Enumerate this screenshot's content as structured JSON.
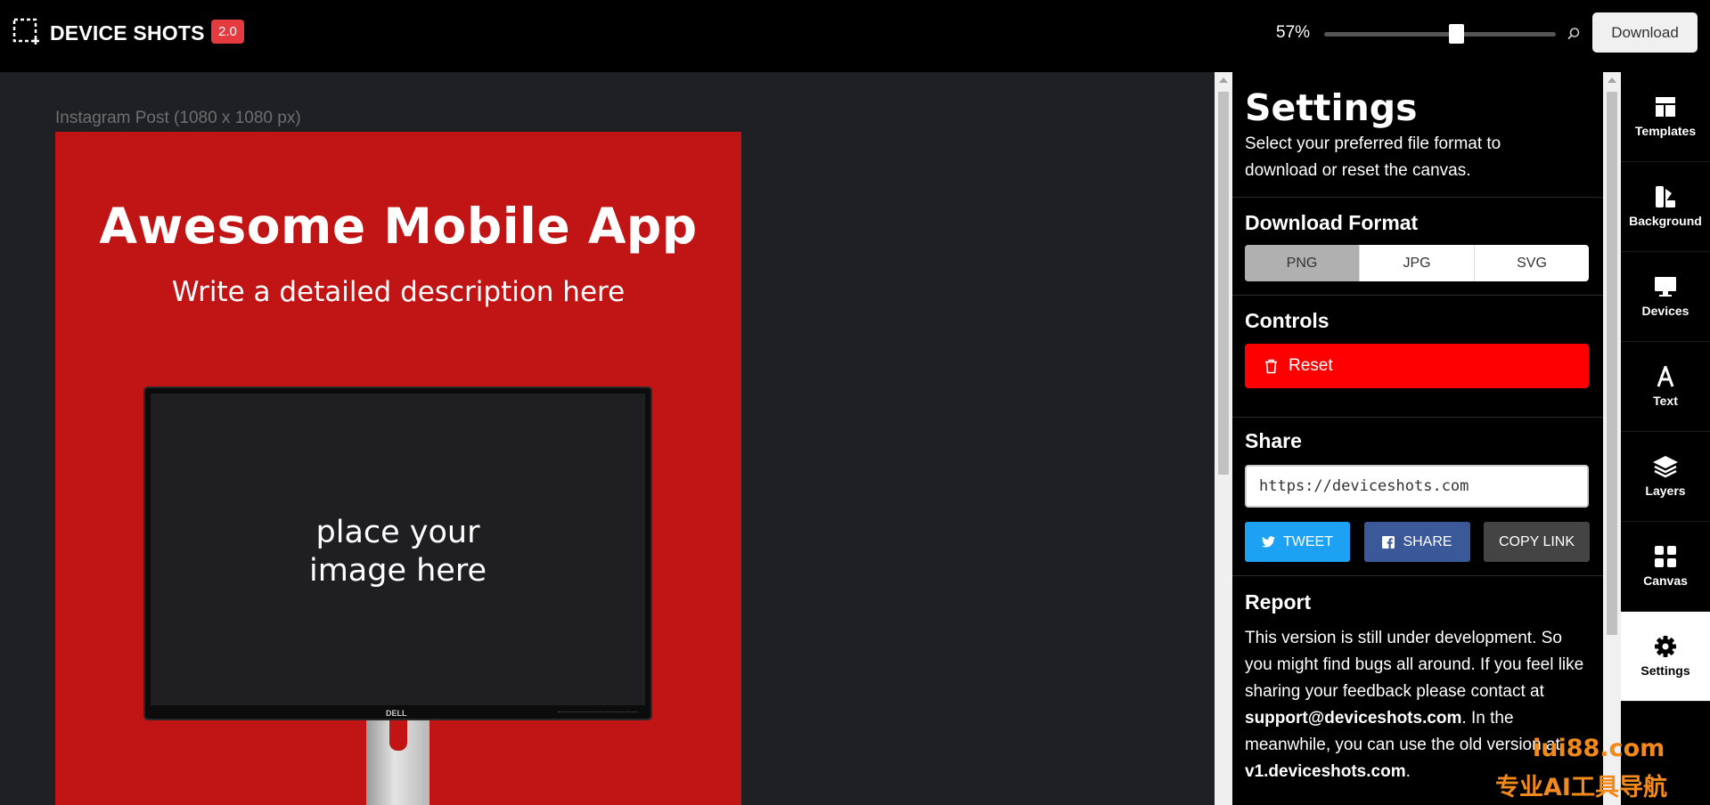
{
  "header": {
    "app_name": "DEVICE SHOTS",
    "version": "2.0",
    "zoom_label": "57%",
    "zoom_value": 0.57,
    "download_label": "Download"
  },
  "canvas": {
    "label": "Instagram Post (1080 x 1080 px)",
    "background_color": "#c11414",
    "title": "Awesome Mobile App",
    "description": "Write a detailed description here",
    "placeholder_line1": "place your",
    "placeholder_line2": "image here",
    "monitor_brand": "DELL"
  },
  "settings": {
    "title": "Settings",
    "subtitle": "Select your preferred file format to download or reset the canvas.",
    "download_format": {
      "title": "Download Format",
      "options": [
        "PNG",
        "JPG",
        "SVG"
      ],
      "selected": "PNG"
    },
    "controls": {
      "title": "Controls",
      "reset_label": "Reset"
    },
    "share": {
      "title": "Share",
      "url": "https://deviceshots.com",
      "tweet_label": "TWEET",
      "share_label": "SHARE",
      "copy_label": "COPY LINK"
    },
    "report": {
      "title": "Report",
      "text_1": "This version is still under development. So you might find bugs all around. If you feel like sharing your feedback please contact at ",
      "email": "support@deviceshots.com",
      "text_2": ". In the meanwhile, you can use the old version at ",
      "old_version": "v1.deviceshots.com",
      "text_3": "."
    }
  },
  "sidebar": {
    "items": [
      {
        "label": "Templates",
        "icon": "templates-icon"
      },
      {
        "label": "Background",
        "icon": "background-icon"
      },
      {
        "label": "Devices",
        "icon": "monitor-icon"
      },
      {
        "label": "Text",
        "icon": "text-icon"
      },
      {
        "label": "Layers",
        "icon": "layers-icon"
      },
      {
        "label": "Canvas",
        "icon": "canvas-grid-icon"
      },
      {
        "label": "Settings",
        "icon": "gear-icon"
      }
    ],
    "active": "Settings"
  },
  "watermark": {
    "line1": "iui88.com",
    "line2": "专业AI工具导航"
  },
  "colors": {
    "accent_red": "#ff0000",
    "badge_red": "#e53a40",
    "twitter_blue": "#1da1f2",
    "facebook_blue": "#3b5998",
    "watermark_orange": "#f28a1b"
  }
}
